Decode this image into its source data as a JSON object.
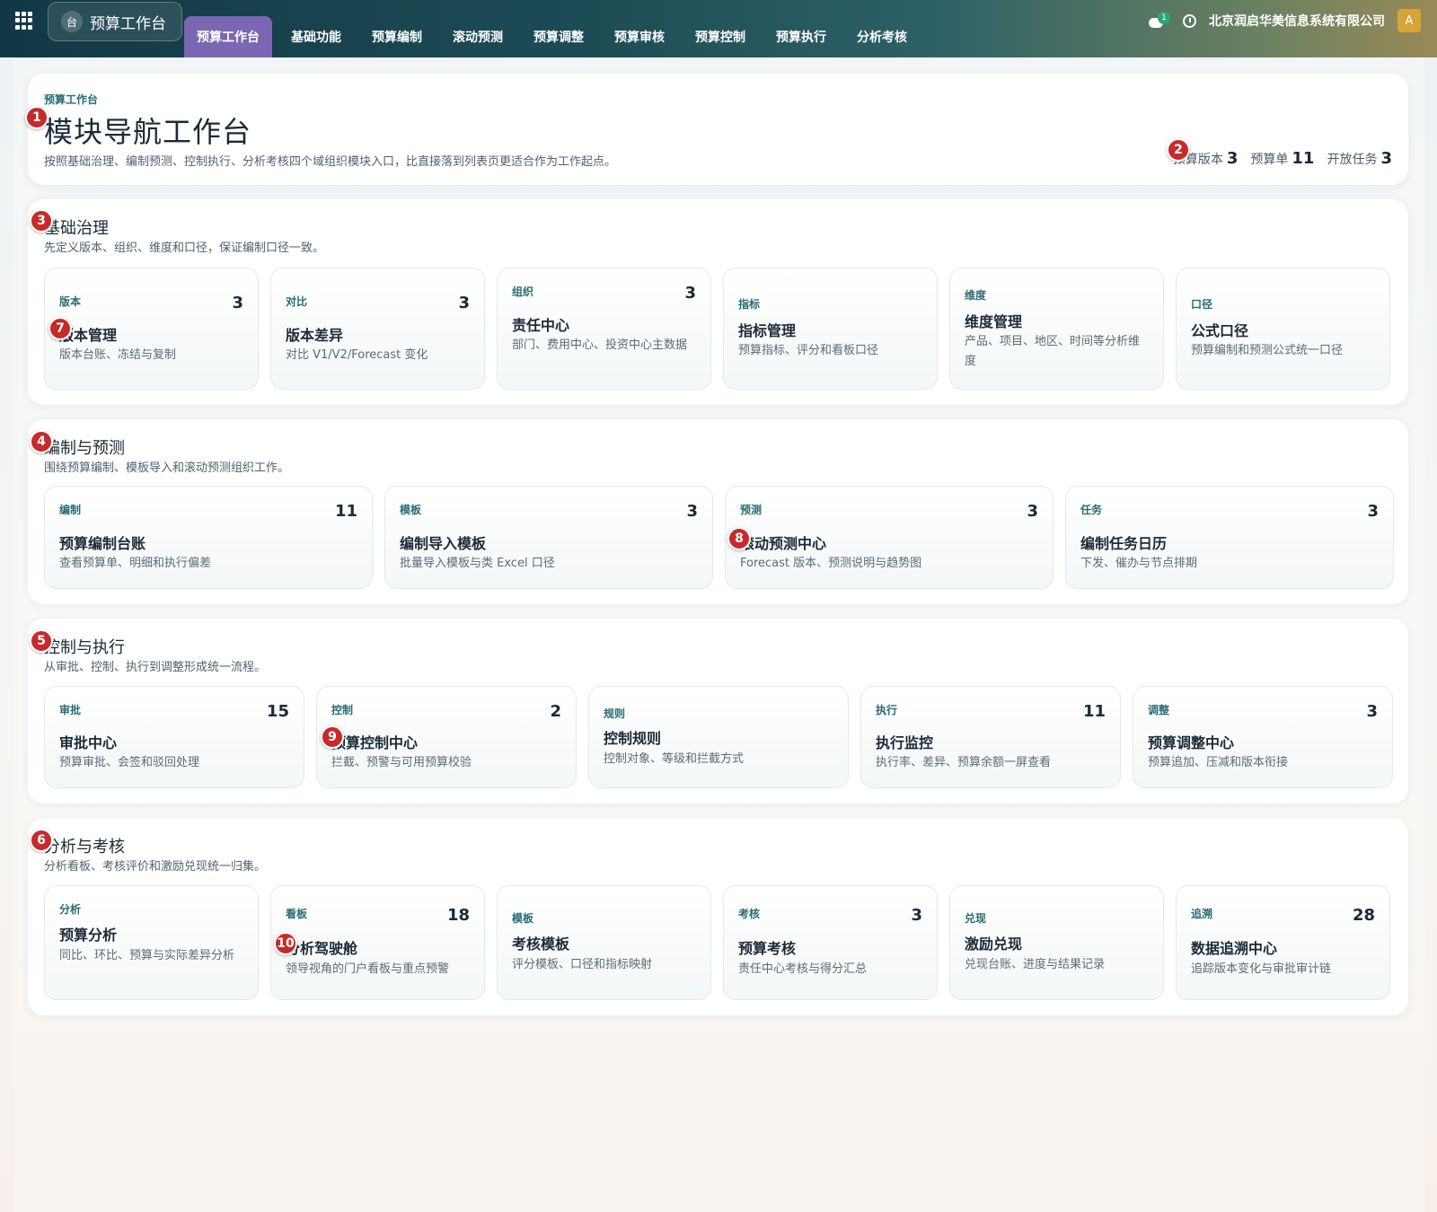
{
  "topbar": {
    "app_icon_text": "台",
    "app_title": "预算工作台",
    "tabs": [
      "预算工作台",
      "基础功能",
      "预算编制",
      "滚动预测",
      "预算调整",
      "预算审核",
      "预算控制",
      "预算执行",
      "分析考核"
    ],
    "message_count": "1",
    "company": "北京润启华美信息系统有限公司",
    "avatar": "A"
  },
  "header": {
    "crumb": "预算工作台",
    "title": "模块导航工作台",
    "desc": "按照基础治理、编制预测、控制执行、分析考核四个域组织模块入口，比直接落到列表页更适合作为工作起点。",
    "stats": [
      {
        "label": "预算版本",
        "value": "3"
      },
      {
        "label": "预算单",
        "value": "11"
      },
      {
        "label": "开放任务",
        "value": "3"
      }
    ]
  },
  "sections": [
    {
      "title": "基础治理",
      "desc": "先定义版本、组织、维度和口径，保证编制口径一致。",
      "tiles": [
        {
          "tag": "版本",
          "count": "3",
          "name": "版本管理",
          "desc": "版本台账、冻结与复制"
        },
        {
          "tag": "对比",
          "count": "3",
          "name": "版本差异",
          "desc": "对比 V1/V2/Forecast 变化"
        },
        {
          "tag": "组织",
          "count": "3",
          "name": "责任中心",
          "desc": "部门、费用中心、投资中心主数据"
        },
        {
          "tag": "指标",
          "count": "",
          "name": "指标管理",
          "desc": "预算指标、评分和看板口径"
        },
        {
          "tag": "维度",
          "count": "",
          "name": "维度管理",
          "desc": "产品、项目、地区、时间等分析维度"
        },
        {
          "tag": "口径",
          "count": "",
          "name": "公式口径",
          "desc": "预算编制和预测公式统一口径"
        }
      ]
    },
    {
      "title": "编制与预测",
      "desc": "围绕预算编制、模板导入和滚动预测组织工作。",
      "tiles": [
        {
          "tag": "编制",
          "count": "11",
          "name": "预算编制台账",
          "desc": "查看预算单、明细和执行偏差"
        },
        {
          "tag": "模板",
          "count": "3",
          "name": "编制导入模板",
          "desc": "批量导入模板与类 Excel 口径"
        },
        {
          "tag": "预测",
          "count": "3",
          "name": "滚动预测中心",
          "desc": "Forecast 版本、预测说明与趋势图"
        },
        {
          "tag": "任务",
          "count": "3",
          "name": "编制任务日历",
          "desc": "下发、催办与节点排期"
        }
      ]
    },
    {
      "title": "控制与执行",
      "desc": "从审批、控制、执行到调整形成统一流程。",
      "tiles": [
        {
          "tag": "审批",
          "count": "15",
          "name": "审批中心",
          "desc": "预算审批、会签和驳回处理"
        },
        {
          "tag": "控制",
          "count": "2",
          "name": "预算控制中心",
          "desc": "拦截、预警与可用预算校验"
        },
        {
          "tag": "规则",
          "count": "",
          "name": "控制规则",
          "desc": "控制对象、等级和拦截方式"
        },
        {
          "tag": "执行",
          "count": "11",
          "name": "执行监控",
          "desc": "执行率、差异、预算余额一屏查看"
        },
        {
          "tag": "调整",
          "count": "3",
          "name": "预算调整中心",
          "desc": "预算追加、压减和版本衔接"
        }
      ]
    },
    {
      "title": "分析与考核",
      "desc": "分析看板、考核评价和激励兑现统一归集。",
      "tiles": [
        {
          "tag": "分析",
          "count": "",
          "name": "预算分析",
          "desc": "同比、环比、预算与实际差异分析"
        },
        {
          "tag": "看板",
          "count": "18",
          "name": "分析驾驶舱",
          "desc": "领导视角的门户看板与重点预警"
        },
        {
          "tag": "模板",
          "count": "",
          "name": "考核模板",
          "desc": "评分模板、口径和指标映射"
        },
        {
          "tag": "考核",
          "count": "3",
          "name": "预算考核",
          "desc": "责任中心考核与得分汇总"
        },
        {
          "tag": "兑现",
          "count": "",
          "name": "激励兑现",
          "desc": "兑现台账、进度与结果记录"
        },
        {
          "tag": "追溯",
          "count": "28",
          "name": "数据追溯中心",
          "desc": "追踪版本变化与审批审计链"
        }
      ]
    }
  ],
  "markers": [
    "1",
    "2",
    "3",
    "4",
    "5",
    "6",
    "7",
    "8",
    "9",
    "10"
  ]
}
